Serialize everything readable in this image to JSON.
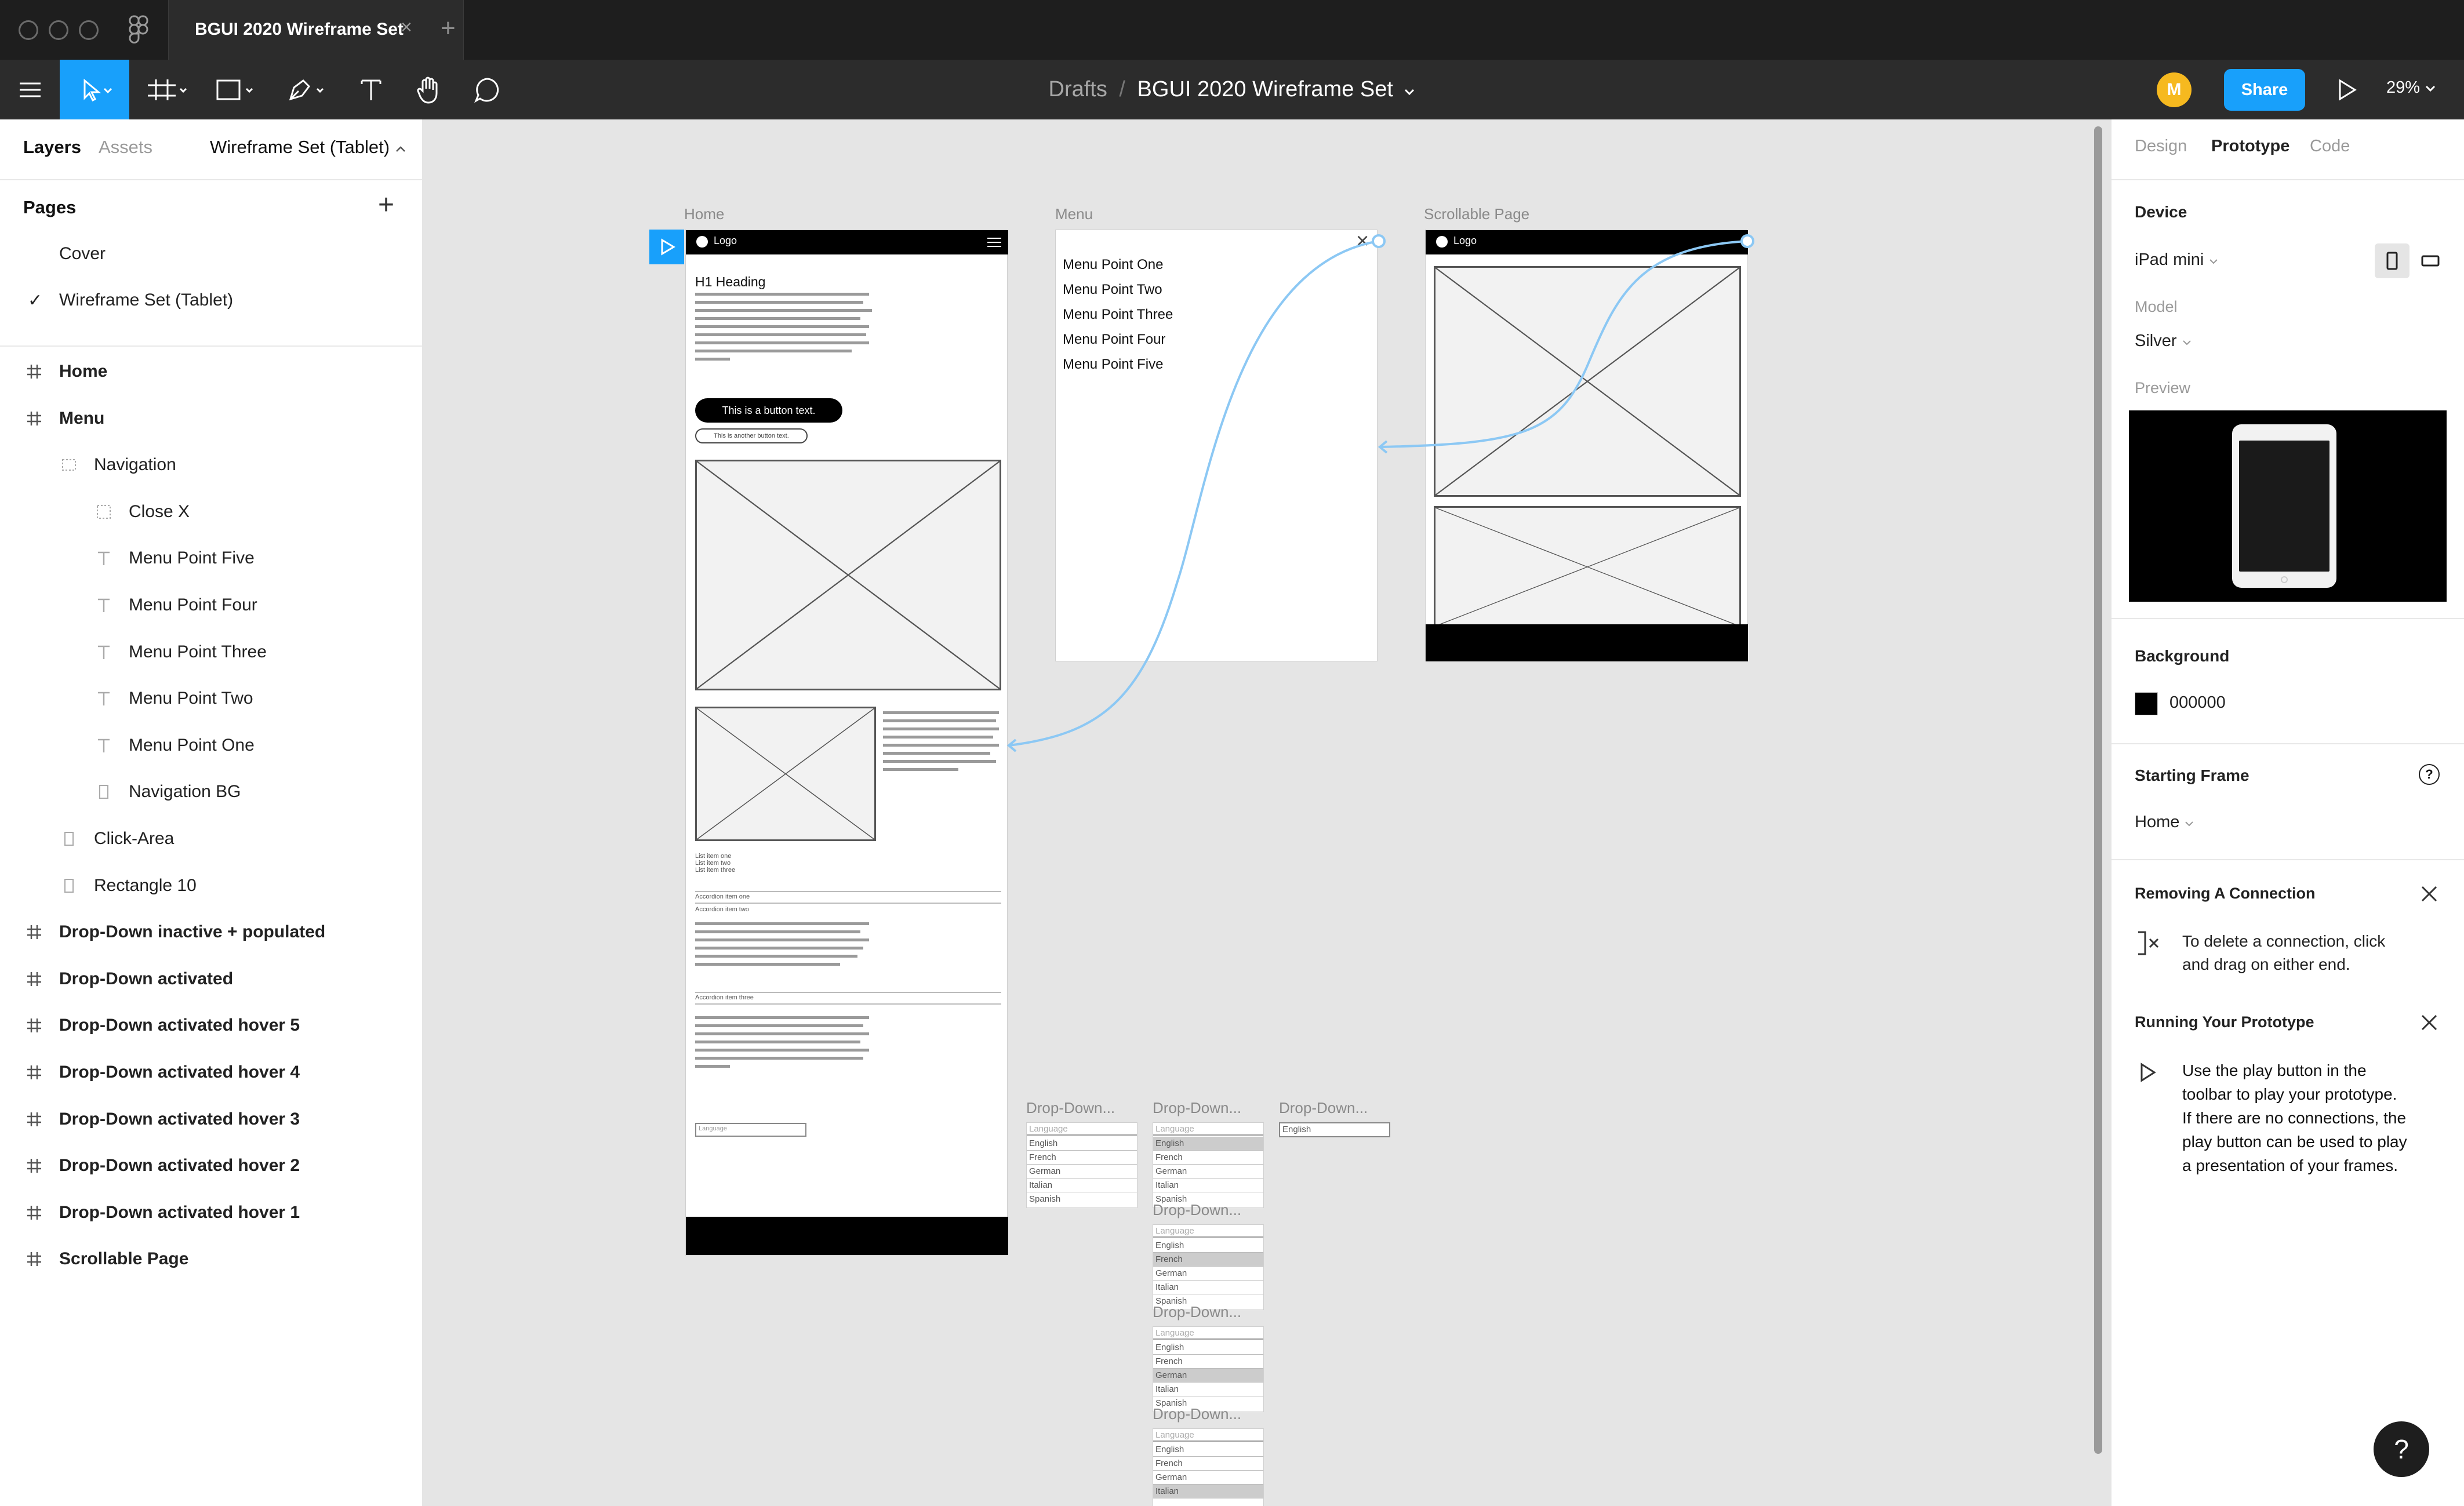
{
  "window": {
    "tab_title": "BGUI 2020 Wireframe Set",
    "tab_close": "×",
    "tab_add": "+"
  },
  "toolbar": {
    "breadcrumb_drafts": "Drafts",
    "breadcrumb_sep": "/",
    "file_name": "BGUI 2020 Wireframe Set",
    "avatar_initial": "M",
    "share_label": "Share",
    "zoom": "29%"
  },
  "left_panel": {
    "tabs": {
      "layers": "Layers",
      "assets": "Assets"
    },
    "page_selector": "Wireframe Set (Tablet)",
    "pages_title": "Pages",
    "add_page": "+",
    "pages": [
      "Cover",
      "Wireframe Set (Tablet)"
    ],
    "selected_page_check": "✓",
    "layers": [
      {
        "label": "Home",
        "icon": "frame-icon",
        "depth": 0,
        "bold": true
      },
      {
        "label": "Menu",
        "icon": "frame-icon",
        "depth": 0,
        "bold": true
      },
      {
        "label": "Navigation",
        "icon": "group-icon",
        "depth": 1,
        "bold": false
      },
      {
        "label": "Close X",
        "icon": "component-icon",
        "depth": 2,
        "bold": false
      },
      {
        "label": "Menu Point Five",
        "icon": "text-icon",
        "depth": 2,
        "bold": false
      },
      {
        "label": "Menu Point Four",
        "icon": "text-icon",
        "depth": 2,
        "bold": false
      },
      {
        "label": "Menu Point Three",
        "icon": "text-icon",
        "depth": 2,
        "bold": false
      },
      {
        "label": "Menu Point Two",
        "icon": "text-icon",
        "depth": 2,
        "bold": false
      },
      {
        "label": "Menu Point One",
        "icon": "text-icon",
        "depth": 2,
        "bold": false
      },
      {
        "label": "Navigation BG",
        "icon": "rectangle-icon",
        "depth": 2,
        "bold": false
      },
      {
        "label": "Click-Area",
        "icon": "rectangle-icon",
        "depth": 1,
        "bold": false
      },
      {
        "label": "Rectangle 10",
        "icon": "rectangle-icon",
        "depth": 1,
        "bold": false
      },
      {
        "label": "Drop-Down inactive + populated",
        "icon": "frame-icon",
        "depth": 0,
        "bold": true
      },
      {
        "label": "Drop-Down activated",
        "icon": "frame-icon",
        "depth": 0,
        "bold": true
      },
      {
        "label": "Drop-Down activated hover 5",
        "icon": "frame-icon",
        "depth": 0,
        "bold": true
      },
      {
        "label": "Drop-Down activated hover 4",
        "icon": "frame-icon",
        "depth": 0,
        "bold": true
      },
      {
        "label": "Drop-Down activated hover 3",
        "icon": "frame-icon",
        "depth": 0,
        "bold": true
      },
      {
        "label": "Drop-Down activated hover 2",
        "icon": "frame-icon",
        "depth": 0,
        "bold": true
      },
      {
        "label": "Drop-Down activated hover 1",
        "icon": "frame-icon",
        "depth": 0,
        "bold": true
      },
      {
        "label": "Scrollable Page",
        "icon": "frame-icon",
        "depth": 0,
        "bold": true
      }
    ]
  },
  "canvas": {
    "frame_labels": {
      "home": "Home",
      "menu": "Menu",
      "scrollable": "Scrollable Page"
    },
    "home": {
      "logo": "Logo",
      "heading": "H1 Heading",
      "button_primary": "This is a button text.",
      "button_secondary": "This is another button text.",
      "list": [
        "List item one",
        "List item two",
        "List item three"
      ],
      "accordion": [
        "Accordion item one",
        "Accordion item two",
        "Accordion item three"
      ],
      "language_select": "Language"
    },
    "menu": {
      "close": "×",
      "items": [
        "Menu Point One",
        "Menu Point Two",
        "Menu Point Three",
        "Menu Point Four",
        "Menu Point Five"
      ]
    },
    "scrollable": {
      "logo": "Logo"
    },
    "dropdown_label": "Drop-Down...",
    "dropdown_header": "Language",
    "dropdown_selected": "English",
    "languages": [
      "English",
      "French",
      "German",
      "Italian",
      "Spanish"
    ]
  },
  "right_panel": {
    "tabs": {
      "design": "Design",
      "prototype": "Prototype",
      "code": "Code"
    },
    "device_title": "Device",
    "device": "iPad mini",
    "model_label": "Model",
    "model": "Silver",
    "preview_label": "Preview",
    "background_title": "Background",
    "background_hex": "000000",
    "background_color": "#000000",
    "starting_frame_title": "Starting Frame",
    "starting_frame": "Home",
    "removing_title": "Removing A Connection",
    "removing_text_1": "To delete a connection, click",
    "removing_text_2": "and drag on either end.",
    "running_title": "Running Your Prototype",
    "running_text": [
      "Use the play button in the",
      "toolbar to play your prototype.",
      "If there are no connections, the",
      "play button can be used to play",
      "a presentation of your frames."
    ],
    "help": "?"
  },
  "colors": {
    "accent": "#18a0fb",
    "connection": "#8cc8f4",
    "avatar": "#f6b91f"
  }
}
